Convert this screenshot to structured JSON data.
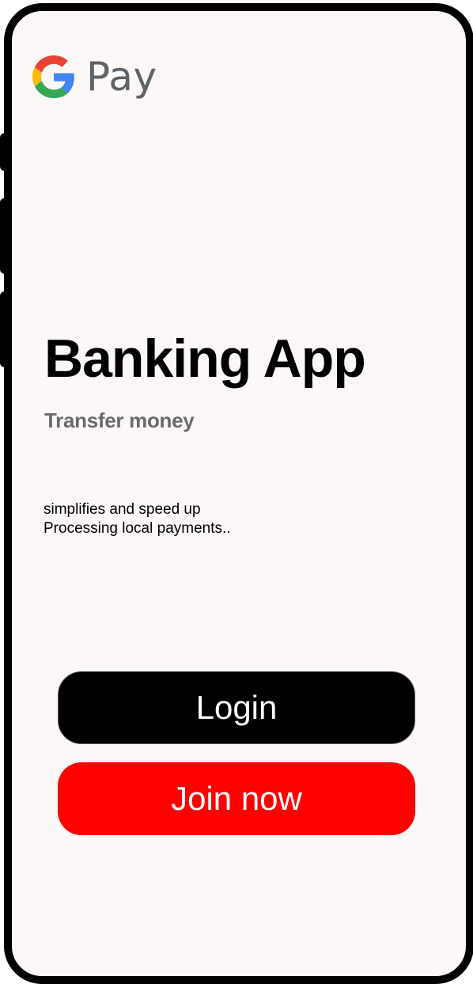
{
  "brand": {
    "logo_icon": "google-g-icon",
    "pay_label": "Pay",
    "colors": {
      "blue": "#4285F4",
      "red": "#EA4335",
      "yellow": "#FBBC05",
      "green": "#34A853",
      "wordmark": "#5f6368"
    }
  },
  "hero": {
    "title": "Banking App",
    "subtitle": "Transfer money",
    "description_line1": "simplifies and speed up",
    "description_line2": "Processing local payments.."
  },
  "actions": {
    "login_label": "Login",
    "join_label": "Join now",
    "login_color": "#000000",
    "join_color": "#ff0000"
  }
}
